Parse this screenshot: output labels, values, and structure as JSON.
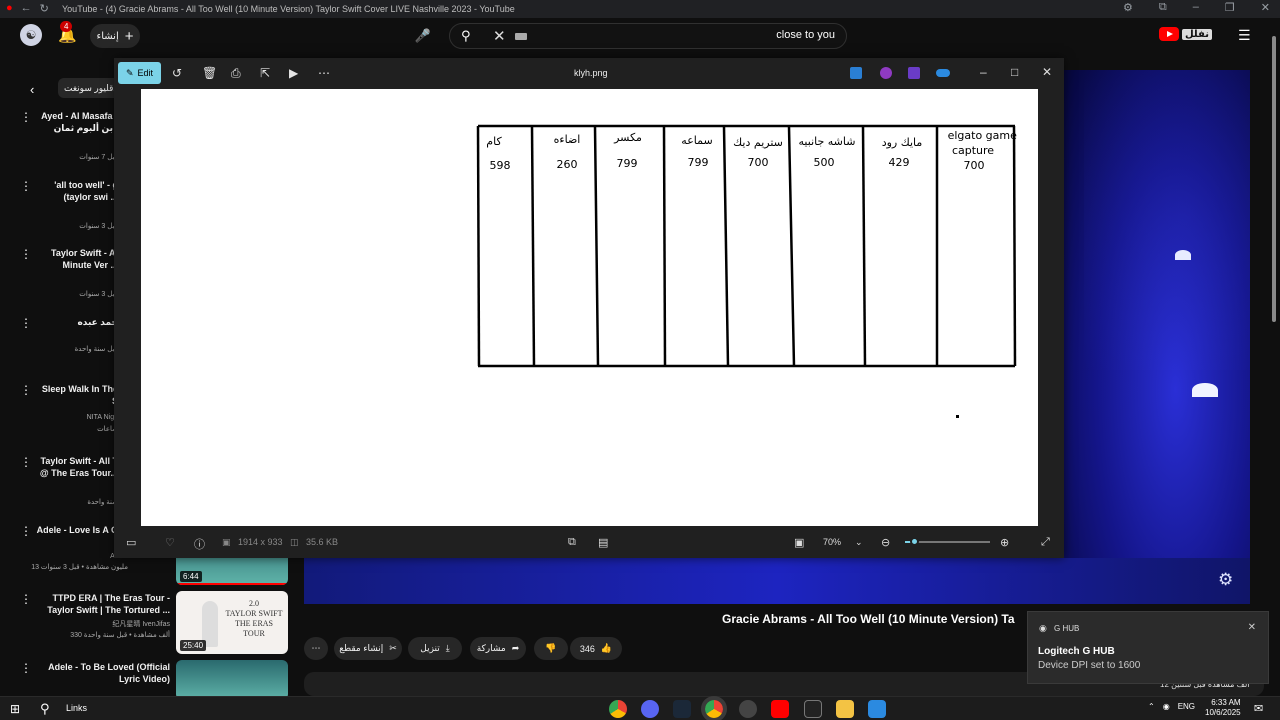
{
  "browser": {
    "tab_title": "YouTube - (4) Gracie Abrams - All Too Well (10 Minute Version) Taylor Swift Cover LIVE Nashville 2023 - YouTube"
  },
  "header": {
    "notification_count": "4",
    "create_label": "إنشاء",
    "search_value": "close to you",
    "logo_text": "نفلل"
  },
  "sidebar": {
    "chip_label": "دقليور سونغت",
    "items": [
      {
        "title": "Ayed - Al Masafa (\nبن ألبوم ثمان | (lbum...",
        "meta": "قبل 7 سنوات"
      },
      {
        "title": "'all too well' - g\n(taylor swi ...",
        "meta": "قبل 3 سنوات"
      },
      {
        "title": "Taylor Swift - Al\nMinute Ver ...",
        "meta": "قبل 3 سنوات"
      },
      {
        "title": "حمد عبده",
        "meta": "قبل سنة واحدة"
      },
      {
        "title": "Sleep Walk In The\nS",
        "meta": "NITA Nigh\nساعات"
      },
      {
        "title": "Taylor Swift - All T\n@ The Eras Tour...",
        "meta": "سنة واحدة"
      },
      {
        "title": "Adele - Love Is A G",
        "meta": "Adele\n13 مليون مشاهدة • قبل 3 سنوات"
      },
      {
        "title": "TTPD ERA | The Eras Tour -\nTaylor Swift | The Tortured ...",
        "meta": "纪凡星晴 IvenJifas\n330 ألف مشاهدة • قبل سنة واحدة"
      },
      {
        "title": "Adele - To Be Loved (Official\nLyric Video)",
        "meta": ""
      }
    ],
    "thumb_durations": [
      "6:44",
      "25:40"
    ],
    "thumb_text": "2.0\nTAYLOR SWIFT\nTHE ERAS TOUR"
  },
  "video": {
    "title": "Gracie Abrams - All Too Well (10 Minute Version) Ta",
    "likes": "346",
    "share_label": "مشاركة",
    "download_label": "تنزيل",
    "clip_label": "إنشاء مقطع",
    "views_line": "12 ألف مشاهدة قبل سنتين"
  },
  "viewer": {
    "edit_label": "Edit",
    "filename": "klyh.png",
    "dimensions": "1914 x 933",
    "file_size": "35.6 KB",
    "zoom": "70%",
    "zoom_fraction": 0.1,
    "colors": {
      "accent": "#7bd3e8"
    }
  },
  "sketch": {
    "columns": [
      {
        "name": "كام",
        "price": "598"
      },
      {
        "name": "اضاءه",
        "price": "260"
      },
      {
        "name": "مكسر",
        "price": "799"
      },
      {
        "name": "سماعه",
        "price": "799"
      },
      {
        "name": "ستريم ديك",
        "price": "700"
      },
      {
        "name": "شاشه جانبيه",
        "price": "500"
      },
      {
        "name": "مايك رود",
        "price": "429"
      },
      {
        "name": "elgato game capture",
        "price": "700"
      }
    ]
  },
  "toast": {
    "app": "G HUB",
    "heading": "Logitech G HUB",
    "body": "Device DPI set to 1600"
  },
  "taskbar": {
    "search_label": "Links",
    "language": "ENG",
    "time": "6:33 AM",
    "date": "10/6/2025"
  }
}
